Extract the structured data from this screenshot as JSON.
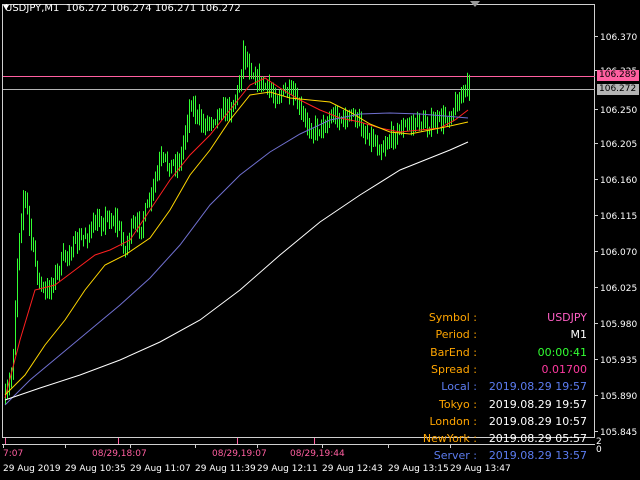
{
  "header": {
    "title": "USDJPY,M1  106.272 106.274 106.271 106.272"
  },
  "price_axis": {
    "labels": [
      "106.370",
      "106.325",
      "106.289",
      "106.272",
      "106.250",
      "106.205",
      "106.160",
      "106.115",
      "106.070",
      "106.025",
      "105.980",
      "105.935",
      "105.890",
      "105.845"
    ],
    "bid_label": "106.272",
    "alert_label": "106.289"
  },
  "time_axis": {
    "labels": [
      "29 Aug 2019",
      "29 Aug 10:35",
      "29 Aug 11:07",
      "29 Aug 11:39",
      "29 Aug 12:11",
      "29 Aug 12:43",
      "29 Aug 13:15",
      "29 Aug 13:47"
    ],
    "session_marks": [
      "7:07",
      "08/29,18:07",
      "08/29,19:07",
      "08/29,19:44"
    ]
  },
  "corner": {
    "top": "2",
    "bottom": "0"
  },
  "info_panel": {
    "rows": [
      {
        "label": "Symbol :",
        "value": "USDJPY",
        "label_color": "#ffa500",
        "value_color": "#ff5fc4"
      },
      {
        "label": "Period :",
        "value": "M1",
        "label_color": "#ffa500",
        "value_color": "#ffffff"
      },
      {
        "label": "BarEnd :",
        "value": "00:00:41",
        "label_color": "#ffa500",
        "value_color": "#32ff32"
      },
      {
        "label": "Spread :",
        "value": "0.01700",
        "label_color": "#ffa500",
        "value_color": "#ff3aa0"
      },
      {
        "label": "Local :",
        "value": "2019.08.29 19:57",
        "label_color": "#5c7cf0",
        "value_color": "#5c7cf0"
      },
      {
        "label": "Tokyo :",
        "value": "2019.08.29 19:57",
        "label_color": "#ffa500",
        "value_color": "#ffffff"
      },
      {
        "label": "London :",
        "value": "2019.08.29 10:57",
        "label_color": "#ffa500",
        "value_color": "#ffffff"
      },
      {
        "label": "NewYork :",
        "value": "2019.08.29 05:57",
        "label_color": "#ffa500",
        "value_color": "#ffffff"
      },
      {
        "label": "Server :",
        "value": "2019.08.29 13:57",
        "label_color": "#5c7cf0",
        "value_color": "#5c7cf0"
      }
    ]
  },
  "colors": {
    "candles": "#32ff32",
    "ma_fast": "#ff2020",
    "ma_mid": "#ffd700",
    "ma_slow": "#7070d0",
    "ma_long": "#ffffff",
    "bid_line": "#b4b4b4",
    "alert_line": "#ff5fa0",
    "session_marker": "#ff5fa0"
  }
}
